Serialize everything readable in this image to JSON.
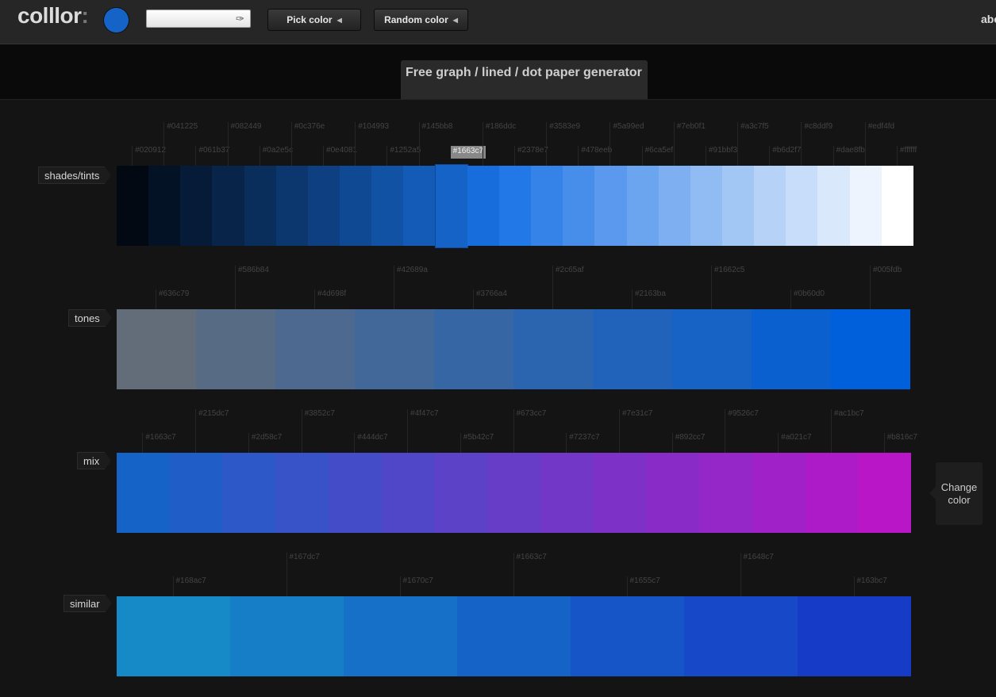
{
  "header": {
    "logo_text": "colllor",
    "logo_colon": ":",
    "current_color": "#1663c7",
    "hex_input": {
      "value": "",
      "placeholder": ""
    },
    "bucket_icon": "paint-bucket-icon",
    "pick_color_label": "Pick color",
    "random_color_label": "Random color",
    "user_text": "abc"
  },
  "banner": {
    "ad_text": "Free graph / lined / dot paper generator"
  },
  "sections": {
    "shades": {
      "label": "shades/tints",
      "selected_index": 10,
      "colors": [
        "#020912",
        "#041225",
        "#061b37",
        "#082449",
        "#0a2e5c",
        "#0c376e",
        "#0e4081",
        "#104993",
        "#1252a5",
        "#145bb8",
        "#1663c7",
        "#186ddc",
        "#2378e7",
        "#3583e9",
        "#478eeb",
        "#5a99ed",
        "#6ca5ef",
        "#7eb0f1",
        "#91bbf3",
        "#a3c7f5",
        "#b6d2f7",
        "#c8ddf9",
        "#dae8fb",
        "#edf4fd",
        "#ffffff"
      ]
    },
    "tones": {
      "label": "tones",
      "colors": [
        "#636c79",
        "#586b84",
        "#4d698f",
        "#42689a",
        "#3766a4",
        "#2c65af",
        "#2163ba",
        "#1662c5",
        "#0b60d0",
        "#005fdb"
      ]
    },
    "mix": {
      "label": "mix",
      "colors": [
        "#1663c7",
        "#215dc7",
        "#2d58c7",
        "#3852c7",
        "#444dc7",
        "#4f47c7",
        "#5b42c7",
        "#673cc7",
        "#7237c7",
        "#7e31c7",
        "#892cc7",
        "#9526c7",
        "#a021c7",
        "#ac1bc7",
        "#b816c7"
      ]
    },
    "similar": {
      "label": "similar",
      "colors": [
        "#168ac7",
        "#167dc7",
        "#1670c7",
        "#1663c7",
        "#1655c7",
        "#1648c7",
        "#163bc7"
      ]
    }
  },
  "change_color_label": "Change color"
}
